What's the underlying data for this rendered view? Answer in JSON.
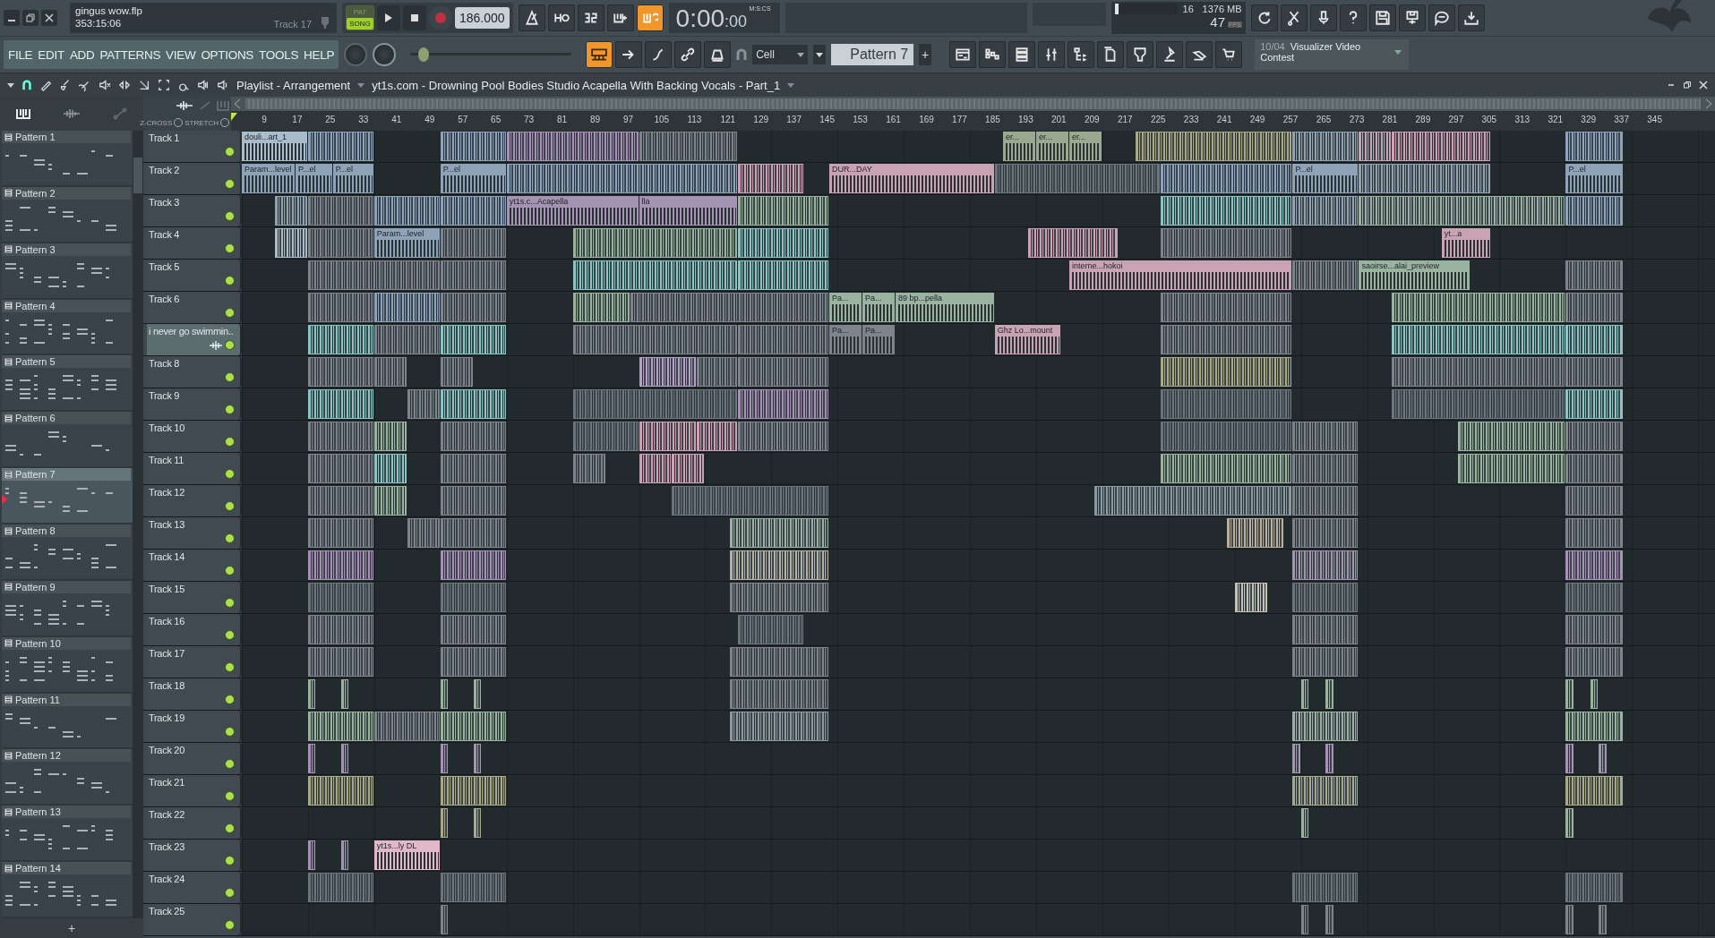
{
  "title_panel": {
    "project": "gingus wow.flp",
    "position": "353:15:06",
    "hint": "Track 17"
  },
  "transport": {
    "modes": [
      {
        "label": "PAT",
        "selected": false
      },
      {
        "label": "SONG",
        "selected": true
      }
    ],
    "recording": false,
    "tempo": "186.000"
  },
  "transport_tools": [
    {
      "on": false
    },
    {
      "on": false
    },
    {
      "on": false
    },
    {
      "on": false
    },
    {
      "on": true
    }
  ],
  "clock": {
    "time": "0:00",
    "centiseconds": ":00",
    "unit": "M:S:CS"
  },
  "monitor": {
    "voices": "16",
    "memory": "1376 MB",
    "fps": "47",
    "fps_unit": "FPS",
    "level": 0.06
  },
  "right_tools": [
    {
      "on": false
    },
    {
      "on": false
    },
    {
      "on": false
    },
    {
      "on": false
    },
    {
      "on": false
    },
    {
      "on": false
    },
    {
      "on": false
    },
    {
      "on": false
    }
  ],
  "menu": [
    "FILE",
    "EDIT",
    "ADD",
    "PATTERNS",
    "VIEW",
    "OPTIONS",
    "TOOLS",
    "HELP"
  ],
  "master": {
    "level": 0.08
  },
  "view_tools": [
    {
      "on": true
    },
    {
      "on": false
    },
    {
      "on": false
    },
    {
      "on": false
    },
    {
      "on": false
    }
  ],
  "snap": "Cell",
  "pattern_selector": "Pattern 7",
  "pattern_add": "+",
  "window_tools": [
    {
      "on": false
    },
    {
      "on": false
    },
    {
      "on": false
    },
    {
      "on": false
    },
    {
      "on": false
    },
    {
      "on": false
    },
    {
      "on": false
    },
    {
      "on": false
    },
    {
      "on": false
    },
    {
      "on": false
    }
  ],
  "news": {
    "date": "10/04",
    "text": "Visualizer Video",
    "text_2": "Contest"
  },
  "playlist": {
    "title": "Playlist - Arrangement",
    "clip_source": "yt1s.com - Drowning Pool  Bodies Studio Acapella With Backing Vocals - Part_1",
    "zero_cross": "Z-CROSS",
    "zero_cross_checked": false,
    "stretch": "STRETCH",
    "stretch_checked": false
  },
  "patterns": [
    {
      "name": "Pattern 1",
      "selected": false
    },
    {
      "name": "Pattern 2",
      "selected": false
    },
    {
      "name": "Pattern 3",
      "selected": false
    },
    {
      "name": "Pattern 4",
      "selected": false
    },
    {
      "name": "Pattern 5",
      "selected": false
    },
    {
      "name": "Pattern 6",
      "selected": false
    },
    {
      "name": "Pattern 7",
      "selected": true
    },
    {
      "name": "Pattern 8",
      "selected": false
    },
    {
      "name": "Pattern 9",
      "selected": false
    },
    {
      "name": "Pattern 10",
      "selected": false
    },
    {
      "name": "Pattern 11",
      "selected": false
    },
    {
      "name": "Pattern 12",
      "selected": false
    },
    {
      "name": "Pattern 13",
      "selected": false
    },
    {
      "name": "Pattern 14",
      "selected": false
    }
  ],
  "pattern_list_add": "+",
  "ruler": [
    "9",
    "17",
    "25",
    "33",
    "41",
    "49",
    "57",
    "65",
    "73",
    "81",
    "89",
    "97",
    "105",
    "113",
    "121",
    "129",
    "137",
    "145",
    "153",
    "161",
    "169",
    "177",
    "185",
    "193",
    "201",
    "209",
    "217",
    "225",
    "233",
    "241",
    "249",
    "257",
    "265",
    "273",
    "281",
    "289",
    "297",
    "305",
    "313",
    "321",
    "329",
    "337",
    "345"
  ],
  "tracks": [
    {
      "name": "Track 1",
      "selected": false,
      "enabled": true,
      "clips": [
        {
          "color": "#a9bccb",
          "label": "douli...art_1"
        },
        {
          "color": "#8fa3b8"
        },
        {
          "color": "#8fa3b8"
        },
        {
          "color": "#a493b3"
        },
        {
          "color": "#7d848c"
        },
        {
          "color": "#9aa890",
          "label": "er..."
        },
        {
          "color": "#9aa890",
          "label": "er..."
        },
        {
          "color": "#9aa890",
          "label": "er..."
        },
        {
          "color": "#a8a88a"
        },
        {
          "color": "#8fa3b8"
        },
        {
          "color": "#c9a3b3"
        },
        {
          "color": "#c9a3b3"
        },
        {
          "color": "#8fa3b8"
        }
      ]
    },
    {
      "name": "Track 2",
      "selected": false,
      "enabled": true,
      "clips": [
        {
          "color": "#8fa3b8",
          "label": "Param...level"
        },
        {
          "color": "#8fa3b8",
          "label": "P...el"
        },
        {
          "color": "#8fa3b8",
          "label": "P...el"
        },
        {
          "color": "#8fa3b8",
          "label": "P...el"
        },
        {
          "color": "#8fa3b8"
        },
        {
          "color": "#c9a3b3"
        },
        {
          "color": "#c9a3b3",
          "label": "DUR...DAY"
        },
        {
          "color": "#6d757c"
        },
        {
          "color": "#8fa3b8"
        },
        {
          "color": "#8fa3b8",
          "label": "P...el"
        },
        {
          "color": "#8fa3b8"
        },
        {
          "color": "#8fa3b8",
          "label": "P...el"
        }
      ]
    },
    {
      "name": "Track 3",
      "selected": false,
      "enabled": true,
      "clips": [
        {
          "color": "#8fa3b8"
        },
        {
          "color": "#7d848c"
        },
        {
          "color": "#8fa3b8"
        },
        {
          "color": "#8fa3b8"
        },
        {
          "color": "#a493b3",
          "label": "yt1s.c...Acapella"
        },
        {
          "color": "#a493b3",
          "label": "lla"
        },
        {
          "color": "#9ab3a0"
        },
        {
          "color": "#8fc3c3"
        },
        {
          "color": "#8fa3b8"
        },
        {
          "color": "#9ab3a0"
        },
        {
          "color": "#8fa3b8"
        }
      ]
    },
    {
      "name": "Track 4",
      "selected": false,
      "enabled": true,
      "clips": [
        {
          "color": "#a9bccb"
        },
        {
          "color": "#7d848c"
        },
        {
          "color": "#8fa3b8",
          "label": "Param...level"
        },
        {
          "color": "#7d848c"
        },
        {
          "color": "#9ab3a0"
        },
        {
          "color": "#8fc3c3"
        },
        {
          "color": "#c9a3b3"
        },
        {
          "color": "#7d848c"
        },
        {
          "color": "#c9a3b3",
          "label": "yt...a"
        }
      ]
    },
    {
      "name": "Track 5",
      "selected": false,
      "enabled": true,
      "clips": [
        {
          "color": "#7d848c"
        },
        {
          "color": "#7d848c"
        },
        {
          "color": "#8fc3c3"
        },
        {
          "color": "#8fc3c3"
        },
        {
          "color": "#c9a3b3",
          "label": "interne...hokoi"
        },
        {
          "color": "#7d848c"
        },
        {
          "color": "#9ab3a0",
          "label": "saoirse...alai_preview"
        },
        {
          "color": "#7d848c"
        }
      ]
    },
    {
      "name": "Track 6",
      "selected": false,
      "enabled": true,
      "clips": [
        {
          "color": "#7d848c"
        },
        {
          "color": "#8fa3b8"
        },
        {
          "color": "#7d848c"
        },
        {
          "color": "#9ab3a0"
        },
        {
          "color": "#7d848c"
        },
        {
          "color": "#9ab3a0",
          "label": "Pa..."
        },
        {
          "color": "#9ab3a0",
          "label": "Pa..."
        },
        {
          "color": "#9ab3a0",
          "label": "89 bp...pella"
        },
        {
          "color": "#7d848c"
        },
        {
          "color": "#9ab3a0"
        },
        {
          "color": "#7d848c"
        }
      ]
    },
    {
      "name": "i never go swimmin..",
      "selected": true,
      "enabled": true,
      "clips": [
        {
          "color": "#8fc3c3"
        },
        {
          "color": "#7d848c"
        },
        {
          "color": "#8fc3c3"
        },
        {
          "color": "#7d848c"
        },
        {
          "color": "#7d848c"
        },
        {
          "color": "#7d848c",
          "label": "Pa..."
        },
        {
          "color": "#7d848c",
          "label": "Pa..."
        },
        {
          "color": "#c9a3b3",
          "label": "Ghz Lo...mount"
        },
        {
          "color": "#7d848c"
        },
        {
          "color": "#8fc3c3"
        },
        {
          "color": "#8fc3c3"
        }
      ]
    },
    {
      "name": "Track 8",
      "selected": false,
      "enabled": true,
      "clips": [
        {
          "color": "#7d848c"
        },
        {
          "color": "#7d848c"
        },
        {
          "color": "#7d848c"
        },
        {
          "color": "#b3a3c3"
        },
        {
          "color": "#7d848c"
        },
        {
          "color": "#7d848c"
        },
        {
          "color": "#a8a88a"
        },
        {
          "color": "#7d848c"
        },
        {
          "color": "#7d848c"
        }
      ]
    },
    {
      "name": "Track 9",
      "selected": false,
      "enabled": true,
      "clips": [
        {
          "color": "#8fc3c3"
        },
        {
          "color": "#7d848c"
        },
        {
          "color": "#8fc3c3"
        },
        {
          "color": "#6d757c"
        },
        {
          "color": "#a493b3"
        },
        {
          "color": "#6d757c"
        },
        {
          "color": "#6d757c"
        },
        {
          "color": "#8fc3c3"
        }
      ]
    },
    {
      "name": "Track 10",
      "selected": false,
      "enabled": true,
      "clips": [
        {
          "color": "#7d848c"
        },
        {
          "color": "#9ab3a0"
        },
        {
          "color": "#7d848c"
        },
        {
          "color": "#6d757c"
        },
        {
          "color": "#c9a3b3"
        },
        {
          "color": "#c9a3b3"
        },
        {
          "color": "#7d848c"
        },
        {
          "color": "#6d757c"
        },
        {
          "color": "#7d848c"
        },
        {
          "color": "#9ab3a0"
        },
        {
          "color": "#7d848c"
        }
      ]
    },
    {
      "name": "Track 11",
      "selected": false,
      "enabled": true,
      "clips": [
        {
          "color": "#7d848c"
        },
        {
          "color": "#8fc3c3"
        },
        {
          "color": "#7d848c"
        },
        {
          "color": "#7d848c"
        },
        {
          "color": "#c9a3b3"
        },
        {
          "color": "#c9a3b3"
        },
        {
          "color": "#9ab3a0"
        },
        {
          "color": "#7d848c"
        },
        {
          "color": "#9ab3a0"
        },
        {
          "color": "#7d848c"
        }
      ]
    },
    {
      "name": "Track 12",
      "selected": false,
      "enabled": true,
      "clips": [
        {
          "color": "#7d848c"
        },
        {
          "color": "#9ab3a0"
        },
        {
          "color": "#7d848c"
        },
        {
          "color": "#6d757c"
        },
        {
          "color": "#8a9aa0"
        },
        {
          "color": "#7d848c"
        },
        {
          "color": "#7d848c"
        }
      ]
    },
    {
      "name": "Track 13",
      "selected": false,
      "enabled": true,
      "clips": [
        {
          "color": "#7d848c"
        },
        {
          "color": "#7d848c"
        },
        {
          "color": "#7d848c"
        },
        {
          "color": "#9ab3a0"
        },
        {
          "color": "#b8b0a0"
        },
        {
          "color": "#7d848c"
        },
        {
          "color": "#7d848c"
        }
      ]
    },
    {
      "name": "Track 14",
      "selected": false,
      "enabled": true,
      "clips": [
        {
          "color": "#a493b3"
        },
        {
          "color": "#a493b3"
        },
        {
          "color": "#b8b0a0"
        },
        {
          "color": "#a493b3"
        },
        {
          "color": "#a493b3"
        }
      ]
    },
    {
      "name": "Track 15",
      "selected": false,
      "enabled": true,
      "clips": [
        {
          "color": "#6d757c"
        },
        {
          "color": "#6d757c"
        },
        {
          "color": "#7d848c"
        },
        {
          "color": "#c8c0b0"
        },
        {
          "color": "#6d757c"
        },
        {
          "color": "#6d757c"
        }
      ]
    },
    {
      "name": "Track 16",
      "selected": false,
      "enabled": true,
      "clips": [
        {
          "color": "#7d848c"
        },
        {
          "color": "#7d848c"
        },
        {
          "color": "#6d757c"
        },
        {
          "color": "#7d848c"
        },
        {
          "color": "#7d848c"
        }
      ]
    },
    {
      "name": "Track 17",
      "selected": false,
      "enabled": true,
      "clips": [
        {
          "color": "#7d848c"
        },
        {
          "color": "#7d848c"
        },
        {
          "color": "#7d848c"
        },
        {
          "color": "#7d848c"
        },
        {
          "color": "#7d848c"
        }
      ]
    },
    {
      "name": "Track 18",
      "selected": false,
      "enabled": true,
      "clips": [
        {
          "color": "#9ab3a0"
        },
        {
          "color": "#9ab3a0"
        },
        {
          "color": "#9ab3a0"
        },
        {
          "color": "#9ab3a0"
        },
        {
          "color": "#7d848c"
        },
        {
          "color": "#9ab3a0"
        },
        {
          "color": "#9ab3a0"
        },
        {
          "color": "#9ab3a0"
        },
        {
          "color": "#9ab3a0"
        }
      ]
    },
    {
      "name": "Track 19",
      "selected": false,
      "enabled": true,
      "clips": [
        {
          "color": "#9ab3a0"
        },
        {
          "color": "#7d848c"
        },
        {
          "color": "#9ab3a0"
        },
        {
          "color": "#8a9aa0"
        },
        {
          "color": "#9ab3a0"
        },
        {
          "color": "#9ab3a0"
        }
      ]
    },
    {
      "name": "Track 20",
      "selected": false,
      "enabled": true,
      "clips": [
        {
          "color": "#a493b3"
        },
        {
          "color": "#a493b3"
        },
        {
          "color": "#a493b3"
        },
        {
          "color": "#a493b3"
        },
        {
          "color": "#a493b3"
        },
        {
          "color": "#a493b3"
        },
        {
          "color": "#a493b3"
        },
        {
          "color": "#a493b3"
        }
      ]
    },
    {
      "name": "Track 21",
      "selected": false,
      "enabled": true,
      "clips": [
        {
          "color": "#a8a88a"
        },
        {
          "color": "#a8a88a"
        },
        {
          "color": "#a8a88a"
        },
        {
          "color": "#a8a88a"
        }
      ]
    },
    {
      "name": "Track 22",
      "selected": false,
      "enabled": true,
      "clips": [
        {
          "color": "#a8a88a"
        },
        {
          "color": "#a8a88a"
        },
        {
          "color": "#9ab3a0"
        },
        {
          "color": "#9ab3a0"
        }
      ]
    },
    {
      "name": "Track 23",
      "selected": false,
      "enabled": true,
      "clips": [
        {
          "color": "#a493b3"
        },
        {
          "color": "#a493b3"
        },
        {
          "color": "#e0b8c8",
          "label": "yt1s...ly DL"
        }
      ]
    },
    {
      "name": "Track 24",
      "selected": false,
      "enabled": true,
      "clips": [
        {
          "color": "#6d757c"
        },
        {
          "color": "#6d757c"
        },
        {
          "color": "#6d757c"
        },
        {
          "color": "#6d757c"
        }
      ]
    },
    {
      "name": "Track 25",
      "selected": false,
      "enabled": true,
      "clips": [
        {
          "color": "#7d848c"
        },
        {
          "color": "#7d848c"
        },
        {
          "color": "#7d848c"
        },
        {
          "color": "#7d848c"
        },
        {
          "color": "#7d848c"
        }
      ]
    }
  ]
}
